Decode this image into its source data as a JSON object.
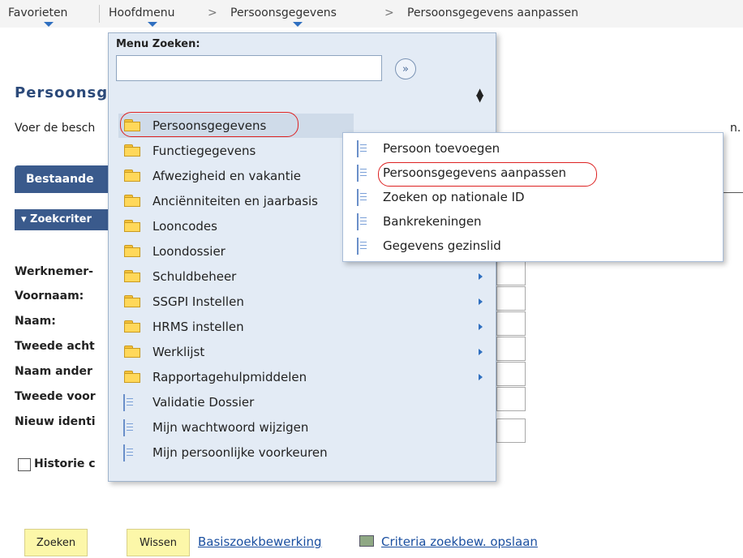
{
  "topnav": {
    "favorites": "Favorieten",
    "main_menu": "Hoofdmenu",
    "sep": ">",
    "crumb1": "Persoonsgegevens",
    "crumb2": "Persoonsgegevens aanpassen"
  },
  "page": {
    "title": "Persoonsg",
    "description": "Voer de besch",
    "description_end": "n.",
    "tab_existing": "Bestaande",
    "criteria_header": "▾ Zoekcriter",
    "fields": [
      {
        "label": "Werknemer-"
      },
      {
        "label": "Voornaam:"
      },
      {
        "label": "Naam:"
      },
      {
        "label": "Tweede acht"
      },
      {
        "label": "Naam ander"
      },
      {
        "label": "Tweede voor"
      },
      {
        "label": "Nieuw identi"
      }
    ],
    "history_label": "Historie c"
  },
  "footer": {
    "search_button": "Zoeken",
    "clear_button": "Wissen",
    "basic_search_link": "Basiszoekbewerking",
    "save_criteria_link": "Criteria zoekbew. opslaan"
  },
  "menu": {
    "search_label": "Menu Zoeken:",
    "search_value": "",
    "go_icon": "»",
    "sort_icon": "▲▼",
    "items": [
      {
        "label": "Persoonsgegevens",
        "icon": "folder-icon",
        "arrow": false,
        "selected": true
      },
      {
        "label": "Functiegegevens",
        "icon": "folder-icon",
        "arrow": false
      },
      {
        "label": "Afwezigheid en vakantie",
        "icon": "folder-icon",
        "arrow": false
      },
      {
        "label": "Anciënniteiten en jaarbasis",
        "icon": "folder-icon",
        "arrow": false
      },
      {
        "label": "Looncodes",
        "icon": "folder-icon",
        "arrow": false
      },
      {
        "label": "Loondossier",
        "icon": "folder-icon",
        "arrow": false
      },
      {
        "label": "Schuldbeheer",
        "icon": "folder-icon",
        "arrow": true
      },
      {
        "label": "SSGPI Instellen",
        "icon": "folder-icon",
        "arrow": true
      },
      {
        "label": "HRMS instellen",
        "icon": "folder-icon",
        "arrow": true
      },
      {
        "label": "Werklijst",
        "icon": "folder-icon",
        "arrow": true
      },
      {
        "label": "Rapportagehulpmiddelen",
        "icon": "folder-icon",
        "arrow": true
      },
      {
        "label": "Validatie Dossier",
        "icon": "document-icon",
        "arrow": false
      },
      {
        "label": "Mijn wachtwoord wijzigen",
        "icon": "document-icon",
        "arrow": false
      },
      {
        "label": "Mijn persoonlijke voorkeuren",
        "icon": "document-icon",
        "arrow": false
      }
    ]
  },
  "submenu": {
    "items": [
      {
        "label": "Persoon toevoegen",
        "icon": "document-icon"
      },
      {
        "label": "Persoonsgegevens aanpassen",
        "icon": "document-icon",
        "circled": true
      },
      {
        "label": "Zoeken op nationale ID",
        "icon": "document-icon"
      },
      {
        "label": "Bankrekeningen",
        "icon": "document-icon"
      },
      {
        "label": "Gegevens gezinslid",
        "icon": "document-icon"
      }
    ]
  },
  "colors": {
    "accent_blue": "#3a5a8c",
    "menu_bg": "#e3ebf5",
    "button_yellow": "#fcf7a9",
    "annotation_red": "#d22222",
    "link": "#1a4fa0"
  }
}
